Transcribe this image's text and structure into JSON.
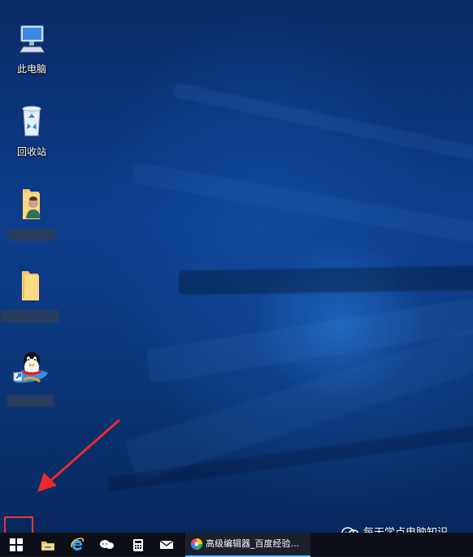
{
  "desktop": {
    "icons": [
      {
        "label": "此电脑",
        "icon": "computer-icon"
      },
      {
        "label": "回收站",
        "icon": "recycle-bin-icon"
      },
      {
        "label": "",
        "icon": "user-folder-icon"
      },
      {
        "label": "",
        "icon": "folder-icon"
      },
      {
        "label": "",
        "icon": "qq-icon"
      }
    ]
  },
  "taskbar": {
    "active_window": "高级编辑器_百度经验...",
    "apps": [
      {
        "icon": "windows-start-icon"
      },
      {
        "icon": "file-explorer-icon"
      },
      {
        "icon": "ie-browser-icon"
      },
      {
        "icon": "wechat-icon"
      },
      {
        "icon": "calculator-icon"
      },
      {
        "icon": "mail-icon"
      },
      {
        "icon": "color-wheel-icon"
      }
    ]
  },
  "watermark": {
    "text": "每天学点电脑知识",
    "icon": "wechat-icon"
  },
  "colors": {
    "taskbar": "#0c0f17",
    "highlight": "#e53935",
    "accent": "#62b7ff"
  }
}
